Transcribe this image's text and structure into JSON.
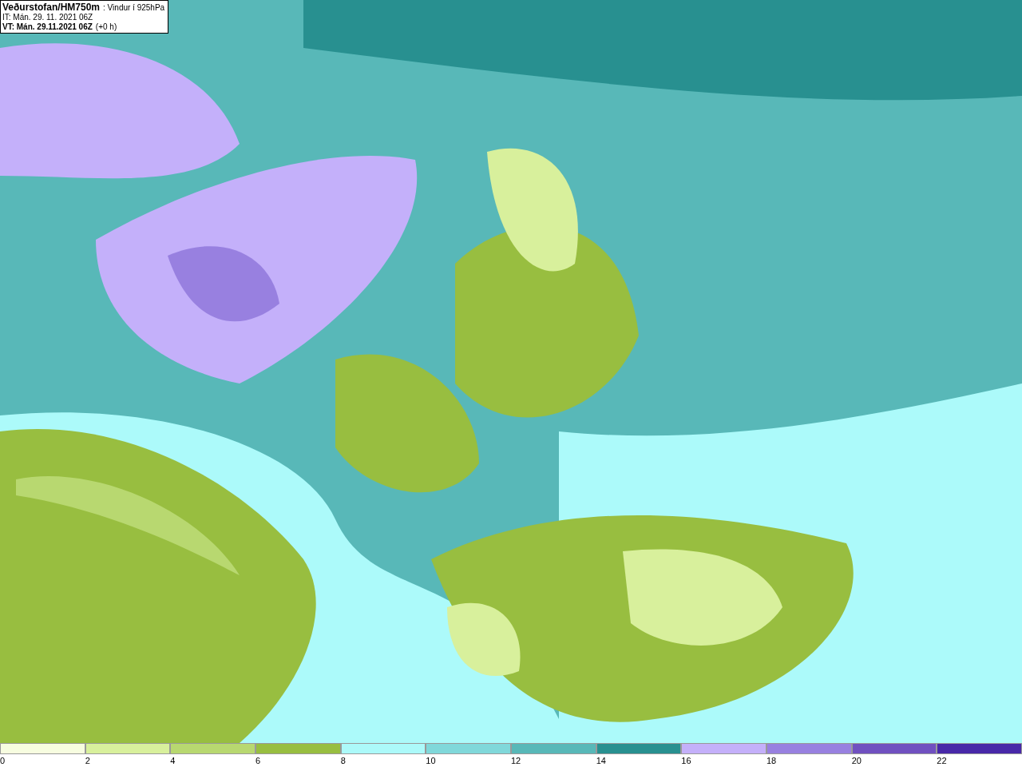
{
  "header": {
    "title": "Veðurstofan/HM750m",
    "subtitle": ": Vindur í 925hPa",
    "issue_time": "IT: Mán. 29. 11. 2021 06Z",
    "valid_time": "VT: Mán. 29.11.2021 06Z",
    "offset": "(+0 h)"
  },
  "legend": [
    {
      "label": "0",
      "color": "#f7fde0"
    },
    {
      "label": "2",
      "color": "#d8f09c"
    },
    {
      "label": "4",
      "color": "#b8d870"
    },
    {
      "label": "6",
      "color": "#98be40"
    },
    {
      "label": "8",
      "color": "#acfafa"
    },
    {
      "label": "10",
      "color": "#80d8da"
    },
    {
      "label": "12",
      "color": "#58b8b8"
    },
    {
      "label": "14",
      "color": "#289090"
    },
    {
      "label": "16",
      "color": "#c4b0fa"
    },
    {
      "label": "18",
      "color": "#9880e0"
    },
    {
      "label": "20",
      "color": "#7050c0"
    },
    {
      "label": "22",
      "color": "#4828a8"
    }
  ]
}
